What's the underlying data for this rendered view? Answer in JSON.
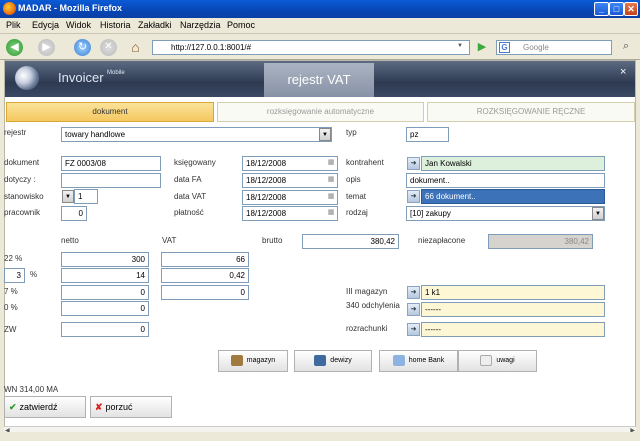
{
  "browser": {
    "title": "MADAR - Mozilla Firefox",
    "url": "http://127.0.0.1:8001/#",
    "search_placeholder": "Google",
    "menu": [
      "Plik",
      "Edycja",
      "Widok",
      "Historia",
      "Zakładki",
      "Narzędzia",
      "Pomoc"
    ]
  },
  "app": {
    "name": "Invoicer",
    "edition": "Mobile",
    "module": "rejestr VAT",
    "close": "×"
  },
  "tabs": [
    "dokument",
    "rozksięgowanie automatyczne",
    "ROZKSIĘGOWANIE RĘCZNE"
  ],
  "form": {
    "rejestr_label": "rejestr",
    "rejestr_value": "towary handlowe",
    "typ_label": "typ",
    "typ_value": "pz",
    "dokument_label": "dokument",
    "dokument_value": "FZ 0003/08",
    "dotyczy_label": "dotyczy :",
    "dotyczy_value": "",
    "stanowisko_label": "stanowisko",
    "stanowisko_value": "1",
    "pracownik_label": "pracownik",
    "pracownik_value": "0",
    "ksiegowany_label": "księgowany",
    "ksiegowany_value": "18/12/2008",
    "datafa_label": "data FA",
    "datafa_value": "18/12/2008",
    "datavat_label": "data VAT",
    "datavat_value": "18/12/2008",
    "platnosc_label": "płatność",
    "platnosc_value": "18/12/2008",
    "kontrahent_label": "kontrahent",
    "kontrahent_value": "Jan Kowalski",
    "opis_label": "opis",
    "opis_value": "dokument..",
    "temat_label": "temat",
    "temat_value": "66 dokument..",
    "rodzaj_label": "rodzaj",
    "rodzaj_value": "[10] zakupy",
    "netto_label": "netto",
    "vat_label": "VAT",
    "brutto_label": "brutto",
    "brutto_value": "380,42",
    "niezaplacone_label": "niezapłacone",
    "niezaplacone_value": "380,42",
    "rows": [
      {
        "label": "22 %",
        "netto": "300",
        "vat": "66"
      },
      {
        "label": "%",
        "rate": "3",
        "netto": "14",
        "vat": "0,42"
      },
      {
        "label": "7 %",
        "netto": "0",
        "vat": "0"
      },
      {
        "label": "0 %",
        "netto": "0"
      },
      {
        "label": "ZW",
        "netto": "0"
      }
    ],
    "magazyn_label": "III magazyn",
    "magazyn_value": "1 k1",
    "odchylenia_label": "340 odchylenia",
    "odchylenia_value": "------",
    "rozrachunki_label": "rozrachunki",
    "rozrachunki_value": "------"
  },
  "actions": [
    "magazyn",
    "dewizy",
    "home Bank",
    "uwagi"
  ],
  "footer": {
    "sum": "WN 314,00 MA",
    "confirm": "zatwierdź",
    "cancel": "porzuć"
  }
}
